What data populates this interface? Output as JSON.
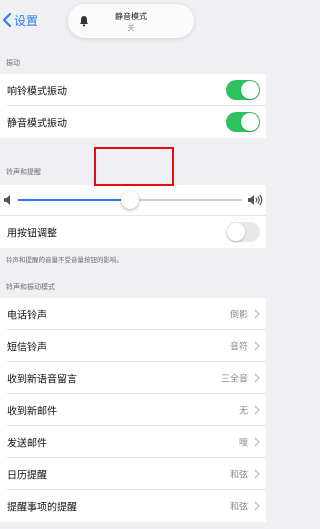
{
  "nav": {
    "back_label": "设置"
  },
  "banner": {
    "title": "静音模式",
    "subtitle": "关"
  },
  "vibrate": {
    "header": "振动",
    "rows": [
      {
        "label": "响铃模式振动",
        "on": true
      },
      {
        "label": "静音模式振动",
        "on": true
      }
    ]
  },
  "ringer": {
    "header": "铃声和提醒",
    "volume_fraction": 0.5,
    "adjust_label": "用按钮调整",
    "adjust_on": false,
    "footnote": "铃声和提醒的音量不受音量按钮的影响。"
  },
  "sounds": {
    "header": "铃声和振动模式",
    "rows": [
      {
        "label": "电话铃声",
        "value": "倒影"
      },
      {
        "label": "短信铃声",
        "value": "音符"
      },
      {
        "label": "收到新语音留言",
        "value": "三全音"
      },
      {
        "label": "收到新邮件",
        "value": "无"
      },
      {
        "label": "发送邮件",
        "value": "嗖"
      },
      {
        "label": "日历提醒",
        "value": "和弦"
      },
      {
        "label": "提醒事项的提醒",
        "value": "和弦"
      }
    ]
  },
  "colors": {
    "accent": "#2b7cf6",
    "toggle_on": "#2fc15e",
    "highlight": "#e01010"
  }
}
